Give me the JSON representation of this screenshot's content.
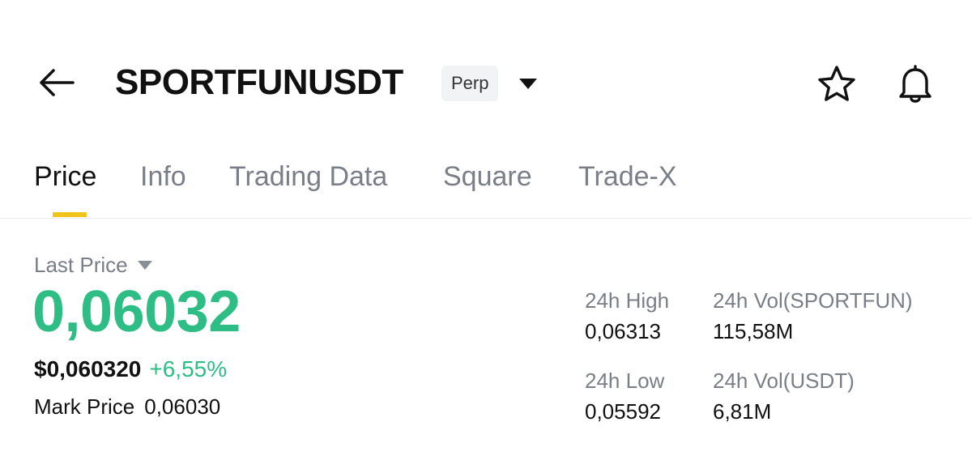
{
  "header": {
    "symbol": "SPORTFUNUSDT",
    "contract_type": "Perp",
    "icons": {
      "back": "arrow-left-icon",
      "dropdown": "caret-down-icon",
      "favorite": "star-icon",
      "alert": "bell-icon"
    }
  },
  "tabs": [
    {
      "label": "Price",
      "active": true
    },
    {
      "label": "Info",
      "active": false
    },
    {
      "label": "Trading Data",
      "active": false
    },
    {
      "label": "Square",
      "active": false
    },
    {
      "label": "Trade-X",
      "active": false
    }
  ],
  "price": {
    "last_price_label": "Last Price",
    "last_price": "0,06032",
    "usd_price": "$0,060320",
    "change_pct": "+6,55%",
    "mark_price_label": "Mark Price",
    "mark_price": "0,06030"
  },
  "stats": {
    "high_label": "24h High",
    "high_value": "0,06313",
    "low_label": "24h Low",
    "low_value": "0,05592",
    "vol_base_label": "24h Vol(SPORTFUN)",
    "vol_base_value": "115,58M",
    "vol_quote_label": "24h Vol(USDT)",
    "vol_quote_value": "6,81M"
  },
  "colors": {
    "positive": "#2ebd85",
    "tab_indicator": "#f0c419",
    "muted_text": "#7a7f87"
  }
}
